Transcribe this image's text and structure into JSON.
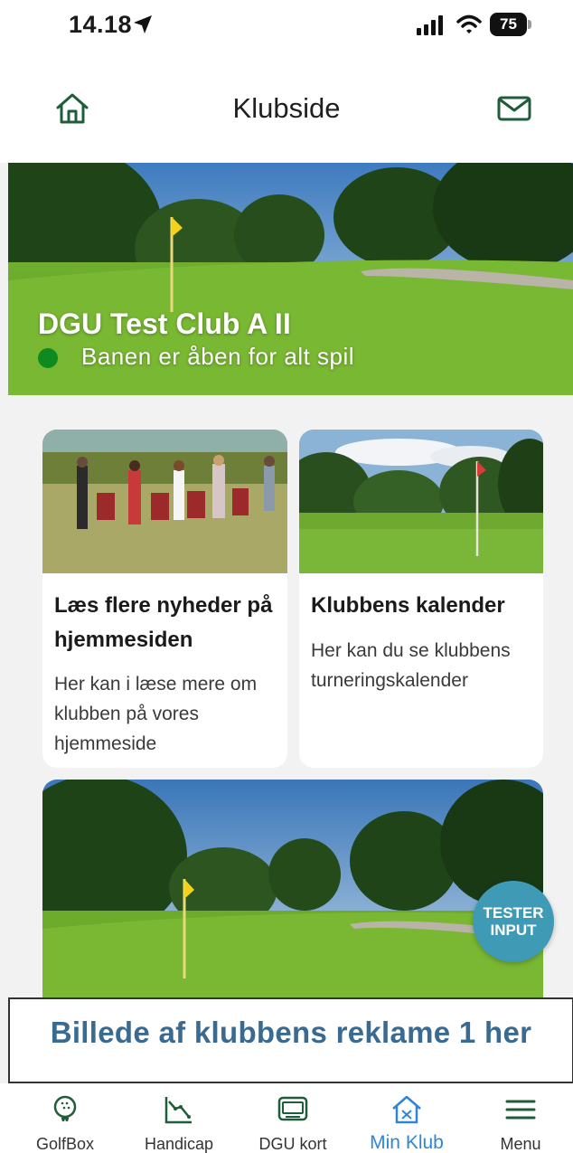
{
  "status_bar": {
    "time": "14.18",
    "battery": "75"
  },
  "header": {
    "title": "Klubside"
  },
  "hero": {
    "club_name": "DGU Test Club A II",
    "course_status": "Banen er åben for alt spil",
    "status_color": "#0f8a1f"
  },
  "cards": [
    {
      "title": "Læs flere nyheder på hjemmesiden",
      "description": "Her kan i læse mere om klubben på vores hjemmeside"
    },
    {
      "title": "Klubbens kalender",
      "description": "Her kan du se klubbens turneringskalender"
    }
  ],
  "tester_button": {
    "line1": "TESTER",
    "line2": "INPUT"
  },
  "ad_banner": {
    "text": "Billede af klubbens reklame 1 her"
  },
  "tabbar": {
    "active_color": "#2e86d6",
    "items": [
      {
        "label": "GolfBox",
        "icon": "golf-ball-icon"
      },
      {
        "label": "Handicap",
        "icon": "chart-icon"
      },
      {
        "label": "DGU kort",
        "icon": "card-icon"
      },
      {
        "label": "Min Klub",
        "icon": "club-house-icon"
      },
      {
        "label": "Menu",
        "icon": "menu-icon"
      }
    ]
  },
  "colors": {
    "brand_green": "#1f5c3a",
    "tester_blue": "#3f9ab5"
  }
}
